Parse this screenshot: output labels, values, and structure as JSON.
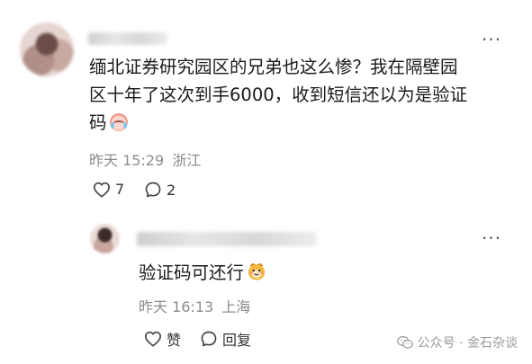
{
  "comment": {
    "text_lines": [
      "缅北证券研究园区的兄弟也这么惨？我在隔壁园",
      "区十年了这次到手6000，收到短信还以为是验证",
      "码"
    ],
    "emoji": "crying-face",
    "time": "昨天 15:29",
    "location": "浙江",
    "likes": "7",
    "replies": "2",
    "more_label": "···"
  },
  "reply": {
    "text": "验证码可还行",
    "emoji": "smiling-bear-face",
    "time": "昨天 16:13",
    "location": "上海",
    "like_label": "赞",
    "reply_label": "回复",
    "more_label": "···"
  },
  "watermark": {
    "text": "公众号 · 金石杂谈"
  },
  "icons": {
    "heart": "heart-icon",
    "comment": "comment-bubble-icon",
    "wechat": "wechat-logo-icon"
  }
}
